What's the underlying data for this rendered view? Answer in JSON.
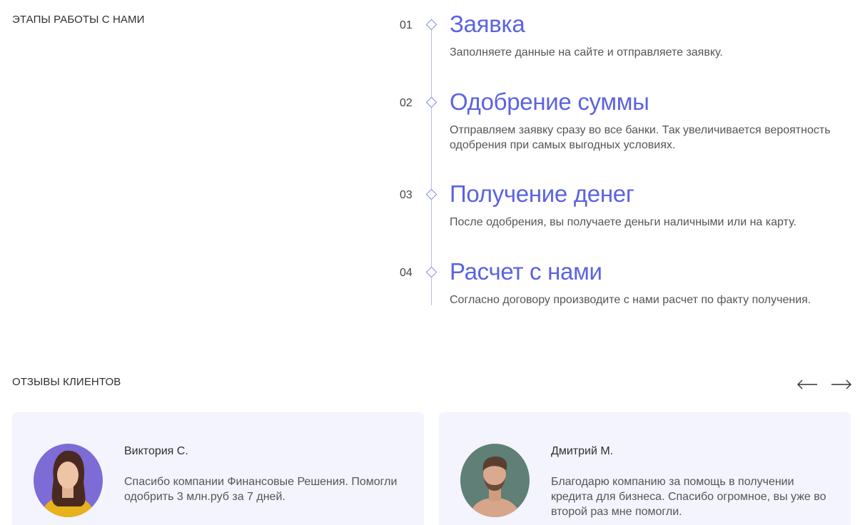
{
  "sections": {
    "steps_label": "ЭТАПЫ РАБОТЫ С НАМИ",
    "reviews_label": "ОТЗЫВЫ КЛИЕНТОВ"
  },
  "steps": [
    {
      "num": "01",
      "title": "Заявка",
      "desc": "Заполняете данные на сайте и отправляете заявку."
    },
    {
      "num": "02",
      "title": "Одобрение суммы",
      "desc": "Отправляем заявку сразу во все банки. Так увеличивается вероятность одобрения при самых выгодных условиях."
    },
    {
      "num": "03",
      "title": "Получение денег",
      "desc": "После одобрения, вы получаете деньги наличными или на карту."
    },
    {
      "num": "04",
      "title": "Расчет с нами",
      "desc": "Согласно договору производите с нами расчет по факту получения."
    }
  ],
  "reviews": [
    {
      "name": "Виктория С.",
      "text": "Спасибо компании Финансовые Решения. Помогли одобрить 3 млн.руб за 7 дней."
    },
    {
      "name": "Дмитрий М.",
      "text": "Благодарю компанию за помощь в получении кредита для бизнеса. Спасибо огромное, вы уже во второй раз мне помогли."
    }
  ],
  "nav": {
    "prev_icon": "arrow-left-icon",
    "next_icon": "arrow-right-icon"
  },
  "colors": {
    "accent": "#5b63e0",
    "timeline": "#b7bdee",
    "card_bg": "#f3f4fd"
  }
}
